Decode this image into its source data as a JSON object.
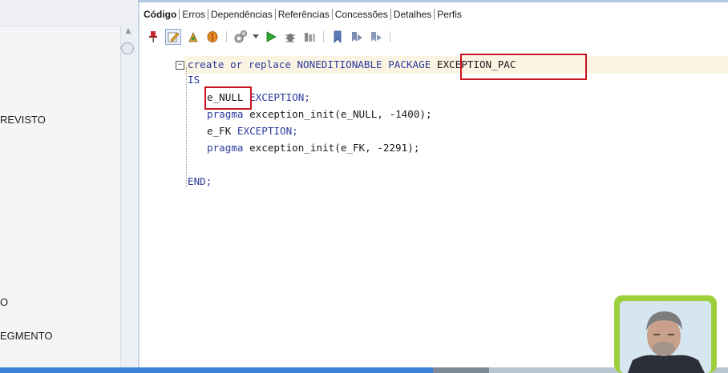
{
  "left_panel": {
    "labels": [
      "REVISTO",
      "O",
      "EGMENTO"
    ]
  },
  "tabs": [
    {
      "label": "Código",
      "active": true
    },
    {
      "label": "Erros",
      "active": false
    },
    {
      "label": "Dependências",
      "active": false
    },
    {
      "label": "Referências",
      "active": false
    },
    {
      "label": "Concessões",
      "active": false
    },
    {
      "label": "Detalhes",
      "active": false
    },
    {
      "label": "Perfis",
      "active": false
    }
  ],
  "toolbar": {
    "icons": [
      "pin-icon",
      "edit-icon",
      "compile-icon",
      "package-icon",
      "settings-icon",
      "dropdown-icon",
      "run-icon",
      "debug-icon",
      "profile-icon",
      "bookmark-icon",
      "bookmark-prev-icon",
      "bookmark-next-icon"
    ]
  },
  "code": {
    "line1_prefix": "create or replace NONEDITIONABLE PACKAGE",
    "line1_name": " EXCEPTION_PAC",
    "line2": "IS",
    "line3_var": "e_NULL",
    "line3_type": " EXCEPTION;",
    "line4_kw": "pragma",
    "line4_rest": " exception_init(e_NULL, ",
    "line4_num": "-1400",
    "line4_end": ");",
    "line5_var": "e_FK",
    "line5_type": " EXCEPTION;",
    "line6_kw": "pragma",
    "line6_rest": " exception_init(e_FK, ",
    "line6_num": "-2291",
    "line6_end": ");",
    "line7": "END;"
  },
  "colors": {
    "highlight_box": "#c8141e",
    "keyword": "#2a3a9c",
    "webcam_border": "#9ccf3a"
  }
}
